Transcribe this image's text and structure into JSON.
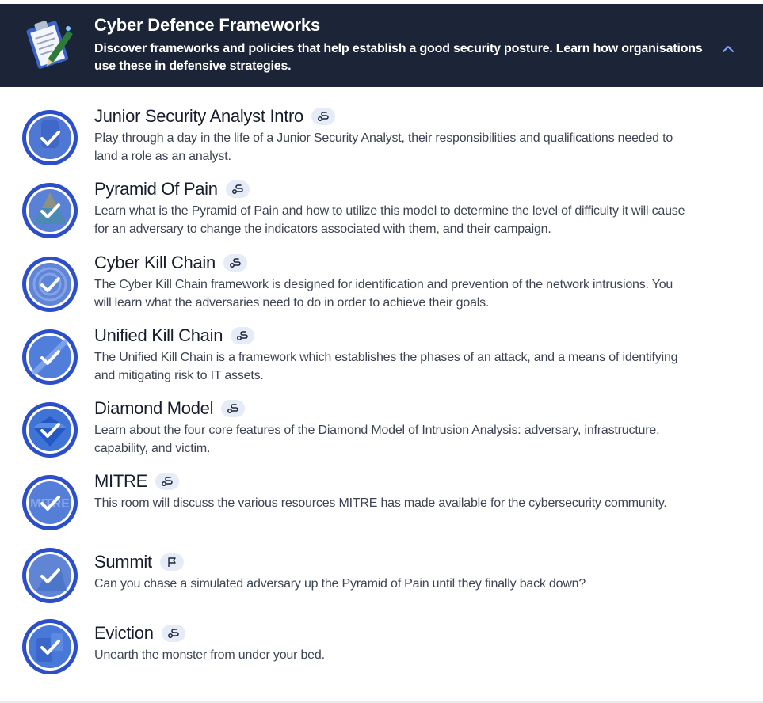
{
  "module": {
    "title": "Cyber Defence Frameworks",
    "description": "Discover frameworks and policies that help establish a good security posture. Learn how organisations use these in defensive strategies.",
    "icon": "clipboard-icon",
    "collapse_icon": "chevron-up-icon"
  },
  "colors": {
    "header_bg": "#1c2538",
    "ring": "#2d4ec9",
    "badge_bg": "#e6ebf8",
    "check": "#ffffff",
    "chevron": "#7fa8ff"
  },
  "rooms": [
    {
      "title": "Junior Security Analyst Intro",
      "type_icon": "walkthrough-icon",
      "description": "Play through a day in the life of a Junior Security Analyst, their responsibilities and qualifications needed to land a role as an analyst.",
      "completed": true
    },
    {
      "title": "Pyramid Of Pain",
      "type_icon": "walkthrough-icon",
      "description": "Learn what is the Pyramid of Pain and how to utilize this model to determine the level of difficulty it will cause for an adversary to change the indicators associated with them, and their campaign.",
      "completed": true
    },
    {
      "title": "Cyber Kill Chain",
      "type_icon": "walkthrough-icon",
      "description": "The Cyber Kill Chain framework is designed for identification and prevention of the network intrusions. You will learn what the adversaries need to do in order to achieve their goals.",
      "completed": true
    },
    {
      "title": "Unified Kill Chain",
      "type_icon": "walkthrough-icon",
      "description": "The Unified Kill Chain is a framework which establishes the phases of an attack, and a means of identifying and mitigating risk to IT assets.",
      "completed": true
    },
    {
      "title": "Diamond Model",
      "type_icon": "walkthrough-icon",
      "description": "Learn about the four core features of the Diamond Model of Intrusion Analysis: adversary, infrastructure, capability, and victim.",
      "completed": true
    },
    {
      "title": "MITRE",
      "type_icon": "walkthrough-icon",
      "description": "This room will discuss the various resources MITRE has made available for the cybersecurity community.",
      "completed": true,
      "icon_text": "MITRE"
    },
    {
      "title": "Summit",
      "type_icon": "flag-icon",
      "description": "Can you chase a simulated adversary up the Pyramid of Pain until they finally back down?",
      "completed": true
    },
    {
      "title": "Eviction",
      "type_icon": "walkthrough-icon",
      "description": "Unearth the monster from under your bed.",
      "completed": true
    }
  ]
}
